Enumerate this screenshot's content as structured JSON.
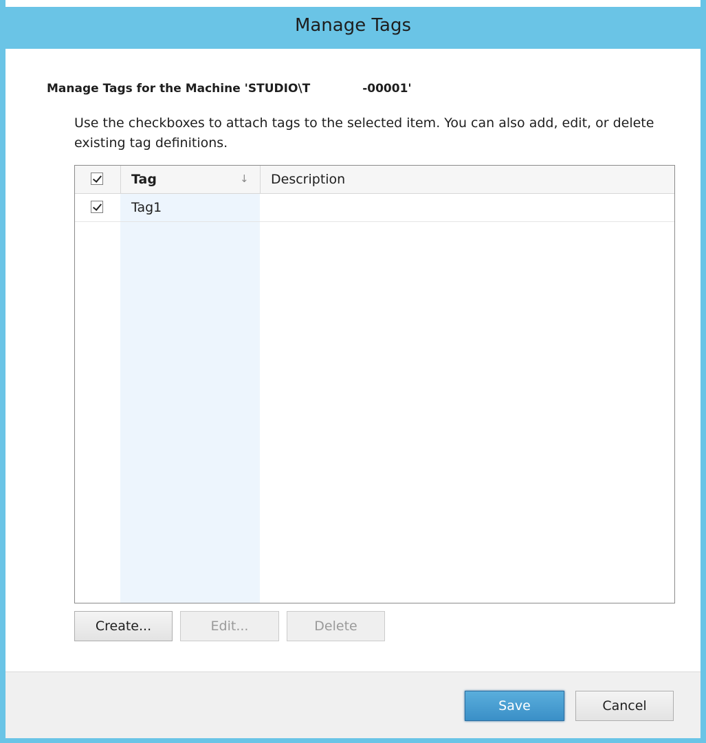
{
  "window": {
    "title": "Manage Tags"
  },
  "heading": {
    "prefix": "Manage Tags for the Machine 'STUDIO\\T",
    "suffix": "-00001'"
  },
  "instructions": "Use the checkboxes to attach tags to the selected item. You can also add, edit, or delete existing tag definitions.",
  "table": {
    "columns": {
      "tag": "Tag",
      "description": "Description"
    },
    "sort_icon": "sort-down-arrow",
    "rows": [
      {
        "checked": true,
        "tag": "Tag1",
        "description": ""
      }
    ]
  },
  "actions": {
    "create": "Create...",
    "edit": "Edit...",
    "delete": "Delete"
  },
  "footer": {
    "save": "Save",
    "cancel": "Cancel"
  },
  "colors": {
    "titlebar": "#6ac4e6",
    "primary_button": "#3a8fc7",
    "selected_column": "#edf5fd"
  }
}
